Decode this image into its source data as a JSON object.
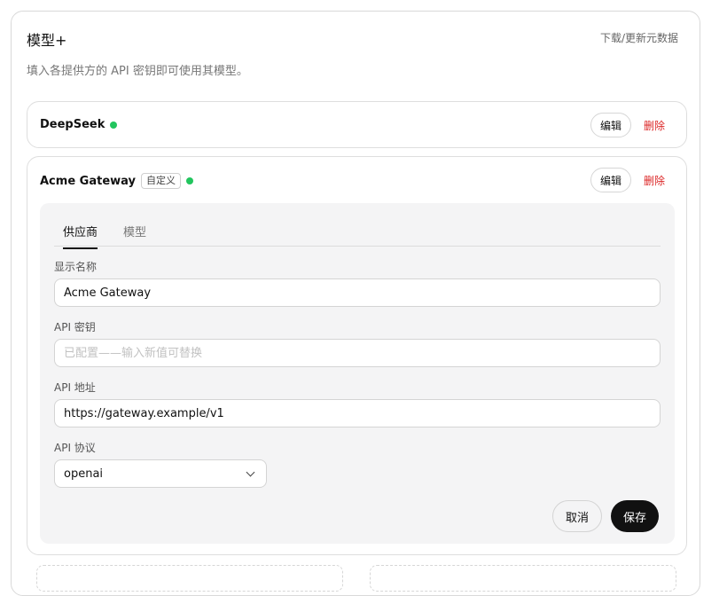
{
  "header": {
    "title": "模型+",
    "update_link": "下载/更新元数据",
    "subtitle": "填入各提供方的 API 密钥即可使用其模型。"
  },
  "providers": [
    {
      "name": "DeepSeek",
      "status": "active",
      "edit_label": "编辑",
      "delete_label": "删除"
    },
    {
      "name": "Acme Gateway",
      "badge": "自定义",
      "status": "active",
      "edit_label": "编辑",
      "delete_label": "删除",
      "tabs": [
        "供应商",
        "模型"
      ],
      "active_tab": "供应商",
      "form": {
        "display_name_label": "显示名称",
        "display_name_value": "Acme Gateway",
        "api_key_label": "API 密钥",
        "api_key_placeholder": "已配置——输入新值可替换",
        "api_url_label": "API 地址",
        "api_url_value": "https://gateway.example/v1",
        "protocol_label": "API 协议",
        "protocol_value": "openai"
      },
      "cancel_label": "取消",
      "save_label": "保存"
    }
  ],
  "colors": {
    "status_active": "#22c55e",
    "danger": "#dc2626",
    "primary_button": "#111111"
  }
}
